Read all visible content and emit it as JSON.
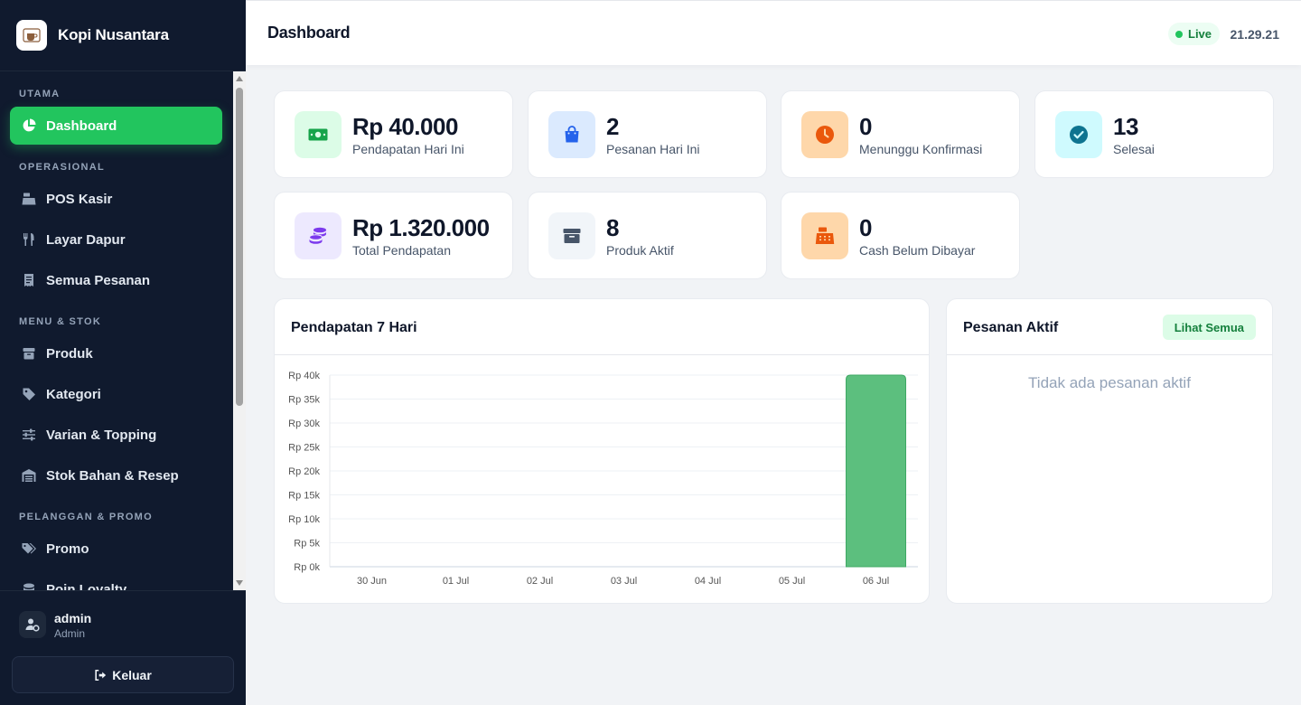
{
  "brand": {
    "name": "Kopi Nusantara"
  },
  "sidebar": {
    "sections": [
      {
        "label": "UTAMA"
      },
      {
        "label": "OPERASIONAL"
      },
      {
        "label": "MENU & STOK"
      },
      {
        "label": "PELANGGAN & PROMO"
      }
    ],
    "items": [
      {
        "label": "Dashboard",
        "icon": "pie-chart-icon",
        "active": true
      },
      {
        "label": "POS Kasir",
        "icon": "cash-register-icon"
      },
      {
        "label": "Layar Dapur",
        "icon": "utensils-icon"
      },
      {
        "label": "Semua Pesanan",
        "icon": "receipt-icon"
      },
      {
        "label": "Produk",
        "icon": "box-icon"
      },
      {
        "label": "Kategori",
        "icon": "tag-icon"
      },
      {
        "label": "Varian & Topping",
        "icon": "sliders-icon"
      },
      {
        "label": "Stok Bahan & Resep",
        "icon": "warehouse-icon"
      },
      {
        "label": "Promo",
        "icon": "tags-icon"
      },
      {
        "label": "Poin Loyalty",
        "icon": "coins-icon"
      }
    ]
  },
  "user": {
    "name": "admin",
    "role": "Admin",
    "logout_label": "Keluar"
  },
  "header": {
    "title": "Dashboard",
    "live_label": "Live",
    "clock": "21.29.21"
  },
  "stats": [
    {
      "value": "Rp 40.000",
      "label": "Pendapatan Hari Ini",
      "icon": "money-icon",
      "color": "#16a34a",
      "bg": "#dcfce7"
    },
    {
      "value": "2",
      "label": "Pesanan Hari Ini",
      "icon": "shopping-bag-icon",
      "color": "#2563eb",
      "bg": "#dbeafe"
    },
    {
      "value": "0",
      "label": "Menunggu Konfirmasi",
      "icon": "clock-icon",
      "color": "#ea580c",
      "bg": "#fed7aa"
    },
    {
      "value": "13",
      "label": "Selesai",
      "icon": "check-circle-icon",
      "color": "#0891b2",
      "bg": "#cffafe"
    },
    {
      "value": "Rp 1.320.000",
      "label": "Total Pendapatan",
      "icon": "coins-icon",
      "color": "#7c3aed",
      "bg": "#ede9fe"
    },
    {
      "value": "8",
      "label": "Produk Aktif",
      "icon": "box-icon",
      "color": "#475569",
      "bg": "#f1f5f9"
    },
    {
      "value": "0",
      "label": "Cash Belum Dibayar",
      "icon": "cash-register-icon",
      "color": "#ea580c",
      "bg": "#fed7aa"
    }
  ],
  "revenue_panel": {
    "title": "Pendapatan 7 Hari"
  },
  "orders_panel": {
    "title": "Pesanan Aktif",
    "view_all_label": "Lihat Semua",
    "empty_text": "Tidak ada pesanan aktif"
  },
  "chart_data": {
    "type": "bar",
    "categories": [
      "30 Jun",
      "01 Jul",
      "02 Jul",
      "03 Jul",
      "04 Jul",
      "05 Jul",
      "06 Jul"
    ],
    "values": [
      0,
      0,
      0,
      0,
      0,
      0,
      40000
    ],
    "y_ticks": [
      "Rp 0k",
      "Rp 5k",
      "Rp 10k",
      "Rp 15k",
      "Rp 20k",
      "Rp 25k",
      "Rp 30k",
      "Rp 35k",
      "Rp 40k"
    ],
    "ylim": [
      0,
      40000
    ],
    "grid": true,
    "bar_color": "#5cbf7e"
  }
}
